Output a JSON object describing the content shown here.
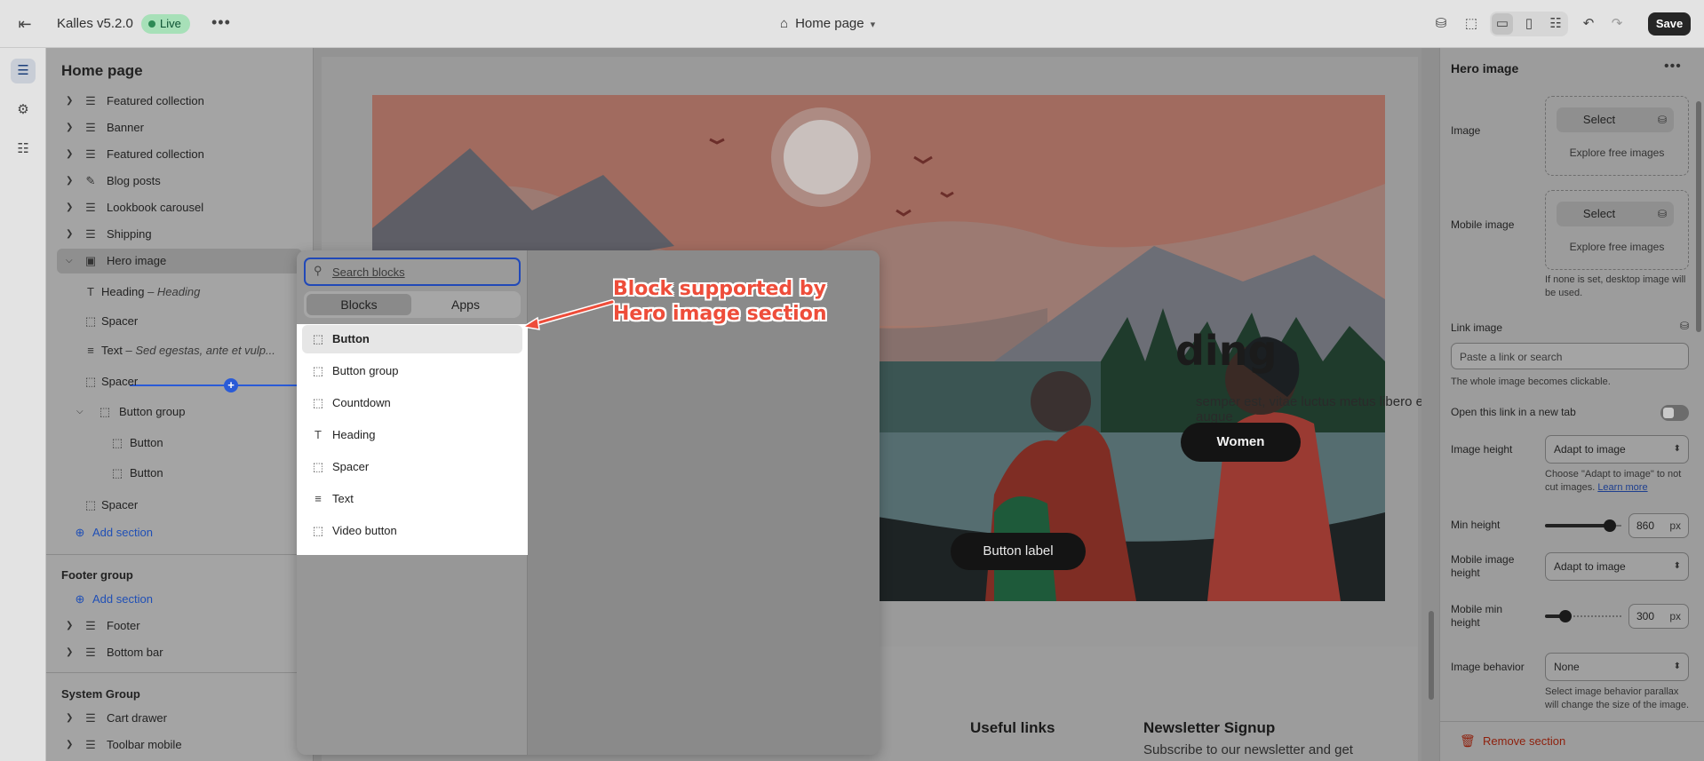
{
  "topbar": {
    "theme_name": "Kalles v5.2.0",
    "status": "Live",
    "page": "Home page",
    "save": "Save"
  },
  "sidebar": {
    "title": "Home page",
    "items": [
      {
        "label": "Featured collection",
        "icon": "section-icon"
      },
      {
        "label": "Banner",
        "icon": "section-icon"
      },
      {
        "label": "Featured collection",
        "icon": "section-icon"
      },
      {
        "label": "Blog posts",
        "icon": "blog-icon"
      },
      {
        "label": "Lookbook carousel",
        "icon": "section-icon"
      },
      {
        "label": "Shipping",
        "icon": "section-icon"
      },
      {
        "label": "Hero image",
        "icon": "image-icon"
      }
    ],
    "hero_blocks": [
      {
        "label": "Heading",
        "sub": "Heading",
        "icon": "text-icon"
      },
      {
        "label": "Spacer",
        "sub": "",
        "icon": "spacer-icon"
      },
      {
        "label": "Text",
        "sub": "Sed egestas, ante et vulp...",
        "icon": "paragraph-icon"
      },
      {
        "label": "Spacer",
        "sub": "",
        "icon": "spacer-icon"
      },
      {
        "label": "Button group",
        "sub": "",
        "icon": "button-icon"
      },
      {
        "label": "Button",
        "sub": "",
        "icon": "button-icon"
      },
      {
        "label": "Button",
        "sub": "",
        "icon": "button-icon"
      },
      {
        "label": "Spacer",
        "sub": "",
        "icon": "spacer-icon"
      }
    ],
    "add_section": "Add section",
    "footer_group": {
      "title": "Footer group",
      "add_section": "Add section",
      "items": [
        "Footer",
        "Bottom bar"
      ]
    },
    "system_group": {
      "title": "System Group",
      "items": [
        "Cart drawer",
        "Toolbar mobile"
      ]
    }
  },
  "picker": {
    "search_placeholder": "Search blocks",
    "tabs": [
      "Blocks",
      "Apps"
    ],
    "blocks": [
      {
        "label": "Button",
        "icon": "button-icon"
      },
      {
        "label": "Button group",
        "icon": "button-icon"
      },
      {
        "label": "Countdown",
        "icon": "spacer-icon"
      },
      {
        "label": "Heading",
        "icon": "text-icon"
      },
      {
        "label": "Spacer",
        "icon": "spacer-icon"
      },
      {
        "label": "Text",
        "icon": "paragraph-icon"
      },
      {
        "label": "Video button",
        "icon": "button-icon"
      }
    ]
  },
  "annotation": {
    "line1": "Block supported by",
    "line2": "Hero image section",
    "color": "#ee4d3a"
  },
  "preview": {
    "heading_fragment": "ding",
    "text_fragment": "semper est, vitae luctus metus libero eu augue",
    "button_women": "Women",
    "button_label": "Button label",
    "footer_useful": "Useful links",
    "footer_newsletter": "Newsletter Signup",
    "footer_newsletter_sub": "Subscribe to our newsletter and get"
  },
  "settings": {
    "title": "Hero image",
    "image_label": "Image",
    "select": "Select",
    "explore": "Explore free images",
    "mobile_image_label": "Mobile image",
    "mobile_help": "If none is set, desktop image will be used.",
    "link_label": "Link image",
    "link_placeholder": "Paste a link or search",
    "link_help": "The whole image becomes clickable.",
    "new_tab_label": "Open this link in a new tab",
    "image_height_label": "Image height",
    "image_height_value": "Adapt to image",
    "image_height_help": "Choose \"Adapt to image\" to not cut images.",
    "learn_more": "Learn more",
    "min_height_label": "Min height",
    "min_height_value": "860",
    "min_height_fraction": 0.85,
    "unit": "px",
    "mobile_height_label": "Mobile image height",
    "mobile_height_value": "Adapt to image",
    "mobile_min_label": "Mobile min height",
    "mobile_min_value": "300",
    "mobile_min_fraction": 0.27,
    "behavior_label": "Image behavior",
    "behavior_value": "None",
    "behavior_help": "Select image behavior parallax will change the size of the image.",
    "remove": "Remove section"
  }
}
